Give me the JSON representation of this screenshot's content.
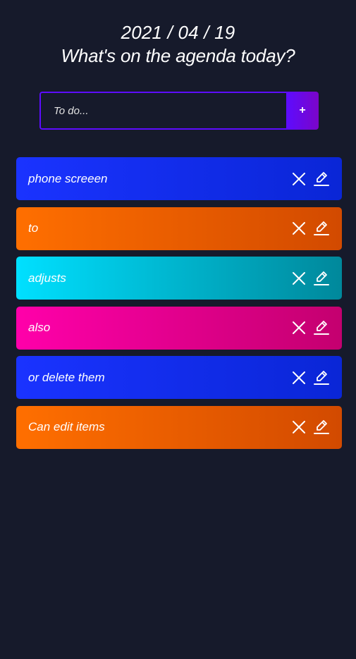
{
  "header": {
    "date": "2021 / 04 / 19",
    "title": "What's on the agenda today?"
  },
  "form": {
    "placeholder": "To do...",
    "add_label": "+"
  },
  "todos": [
    {
      "text": "phone screeen",
      "color": "blue"
    },
    {
      "text": "to",
      "color": "orange"
    },
    {
      "text": "adjusts",
      "color": "cyan"
    },
    {
      "text": "also",
      "color": "pink"
    },
    {
      "text": "or delete them",
      "color": "blue"
    },
    {
      "text": "Can edit items",
      "color": "orange"
    }
  ],
  "icons": {
    "delete": "close-icon",
    "edit": "edit-icon"
  },
  "colors": {
    "background": "#161a2b",
    "accent": "#5d0cff",
    "blue": "#1a33ff",
    "orange": "#ff6f00",
    "cyan": "#00e0ff",
    "pink": "#ff00aa"
  }
}
